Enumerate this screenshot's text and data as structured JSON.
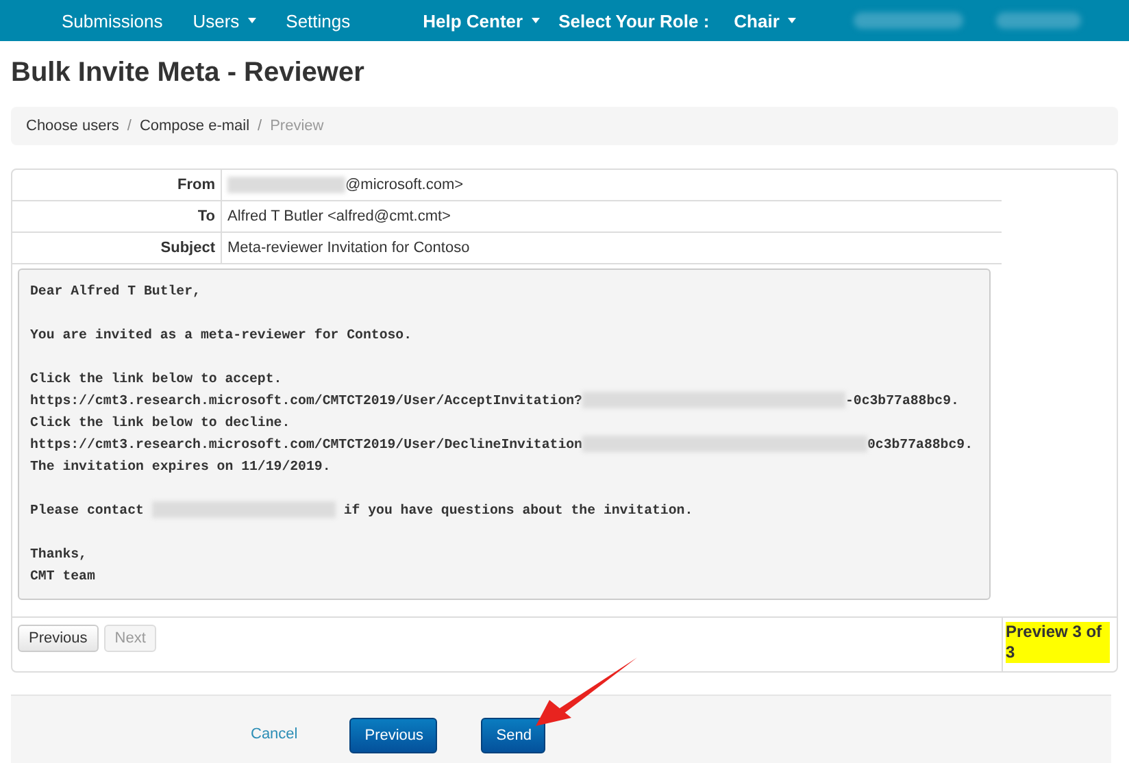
{
  "nav": {
    "items": [
      {
        "label": "Submissions",
        "dropdown": false
      },
      {
        "label": "Users",
        "dropdown": true
      },
      {
        "label": "Settings",
        "dropdown": false
      }
    ],
    "right_items": [
      {
        "label": "Help Center",
        "dropdown": true,
        "kind": "link"
      },
      {
        "label": "Select Your Role :",
        "dropdown": false,
        "kind": "label"
      },
      {
        "label": "Chair",
        "dropdown": true,
        "kind": "link"
      }
    ]
  },
  "page_title": "Bulk Invite Meta - Reviewer",
  "breadcrumb": {
    "separator": "/",
    "items": [
      {
        "label": "Choose users",
        "current": false
      },
      {
        "label": "Compose e-mail",
        "current": false
      },
      {
        "label": "Preview",
        "current": true
      }
    ]
  },
  "email": {
    "fields": [
      {
        "label": "From",
        "parts": [
          {
            "kind": "redacted"
          },
          {
            "kind": "text",
            "text": "@microsoft.com>"
          }
        ]
      },
      {
        "label": "To",
        "parts": [
          {
            "kind": "text",
            "text": "Alfred T Butler <alfred@cmt.cmt>"
          }
        ]
      },
      {
        "label": "Subject",
        "parts": [
          {
            "kind": "text",
            "text": "Meta-reviewer Invitation for Contoso"
          }
        ]
      }
    ],
    "body_lines": [
      {
        "kind": "text",
        "parts": [
          {
            "kind": "text",
            "text": "Dear Alfred T Butler,"
          }
        ]
      },
      {
        "kind": "blank"
      },
      {
        "kind": "text",
        "parts": [
          {
            "kind": "text",
            "text": "You are invited as a meta-reviewer for Contoso."
          }
        ]
      },
      {
        "kind": "blank"
      },
      {
        "kind": "text",
        "parts": [
          {
            "kind": "text",
            "text": "Click the link below to accept."
          }
        ]
      },
      {
        "kind": "text",
        "parts": [
          {
            "kind": "text",
            "text": "https://cmt3.research.microsoft.com/CMTCT2019/User/AcceptInvitation?"
          },
          {
            "kind": "redacted"
          },
          {
            "kind": "text",
            "text": "-0c3b77a88bc9."
          }
        ]
      },
      {
        "kind": "text",
        "parts": [
          {
            "kind": "text",
            "text": "Click the link below to decline."
          }
        ]
      },
      {
        "kind": "text",
        "parts": [
          {
            "kind": "text",
            "text": "https://cmt3.research.microsoft.com/CMTCT2019/User/DeclineInvitation"
          },
          {
            "kind": "redacted"
          },
          {
            "kind": "text",
            "text": "0c3b77a88bc9."
          }
        ]
      },
      {
        "kind": "text",
        "parts": [
          {
            "kind": "text",
            "text": "The invitation expires on 11/19/2019."
          }
        ]
      },
      {
        "kind": "blank"
      },
      {
        "kind": "text",
        "parts": [
          {
            "kind": "text",
            "text": "Please contact "
          },
          {
            "kind": "redacted"
          },
          {
            "kind": "text",
            "text": " if you have questions about the invitation."
          }
        ]
      },
      {
        "kind": "blank"
      },
      {
        "kind": "text",
        "parts": [
          {
            "kind": "text",
            "text": "Thanks,"
          }
        ]
      },
      {
        "kind": "text",
        "parts": [
          {
            "kind": "text",
            "text": "CMT team"
          }
        ]
      }
    ],
    "pager": [
      {
        "label": "Previous",
        "disabled": false
      },
      {
        "label": "Next",
        "disabled": true
      }
    ],
    "preview_status": "Preview 3 of 3"
  },
  "footer": {
    "cancel": "Cancel",
    "buttons": [
      "Previous",
      "Send"
    ]
  }
}
